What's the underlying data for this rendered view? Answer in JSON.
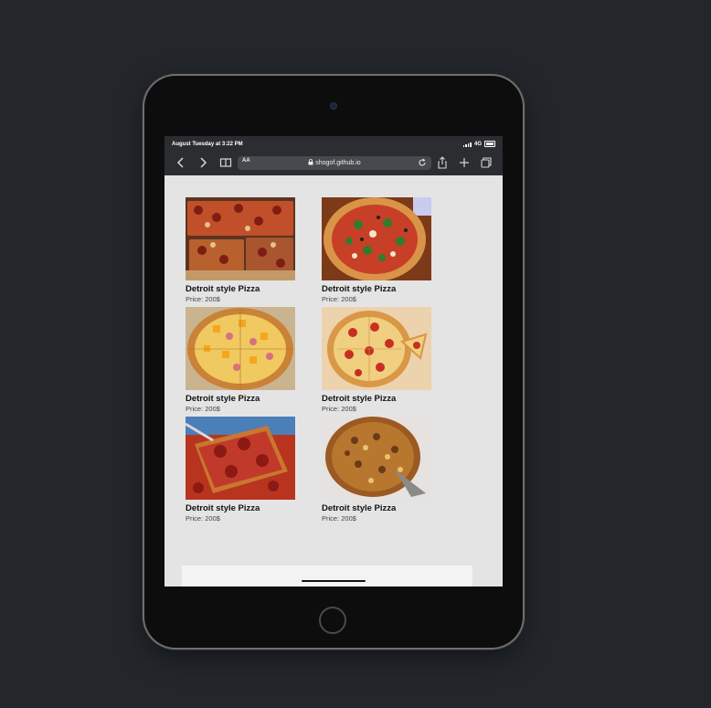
{
  "status_bar": {
    "time": "August Tuesday at 3:22 PM",
    "network": "4G"
  },
  "browser": {
    "text_size_label": "AA",
    "url": "shogof.github.io"
  },
  "products": [
    {
      "title": "Detroit style Pizza",
      "price": "Price: 200$"
    },
    {
      "title": "Detroit style Pizza",
      "price": "Price: 200$"
    },
    {
      "title": "Detroit style Pizza",
      "price": "Price: 200$"
    },
    {
      "title": "Detroit style Pizza",
      "price": "Price: 200$"
    },
    {
      "title": "Detroit style Pizza",
      "price": "Price: 200$"
    },
    {
      "title": "Detroit style Pizza",
      "price": "Price: 200$"
    }
  ],
  "icons": [
    "back-icon",
    "forward-icon",
    "book-icon",
    "lock-icon",
    "reload-icon",
    "share-icon",
    "plus-icon",
    "tabs-icon"
  ]
}
